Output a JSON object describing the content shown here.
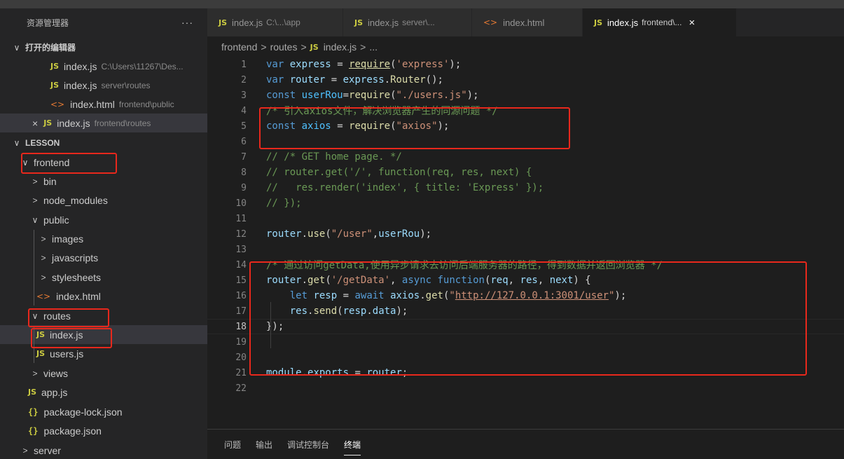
{
  "explorer": {
    "title": "资源管理器",
    "more": "···",
    "open_editors_label": "打开的编辑器",
    "open_editors": [
      {
        "name": "index.js",
        "desc": "C:\\Users\\11267\\Des..."
      },
      {
        "name": "index.js",
        "desc": "server\\routes"
      },
      {
        "name": "index.html",
        "desc": "frontend\\public"
      },
      {
        "name": "index.js",
        "desc": "frontend\\routes"
      }
    ],
    "workspace_label": "LESSON",
    "tree": {
      "frontend": "frontend",
      "bin": "bin",
      "node_modules": "node_modules",
      "public": "public",
      "images": "images",
      "javascripts": "javascripts",
      "stylesheets": "stylesheets",
      "index_html": "index.html",
      "routes": "routes",
      "index_js": "index.js",
      "users_js": "users.js",
      "views": "views",
      "app_js": "app.js",
      "package_lock": "package-lock.json",
      "package_json": "package.json",
      "server": "server"
    }
  },
  "tabs": [
    {
      "name": "index.js",
      "desc": "C:\\...\\app"
    },
    {
      "name": "index.js",
      "desc": "server\\..."
    },
    {
      "name": "index.html",
      "desc": ""
    },
    {
      "name": "index.js",
      "desc": "frontend\\..."
    }
  ],
  "icons": {
    "js": "JS",
    "html": "<>",
    "json": "{}",
    "close": "×",
    "chevron_down": "∨",
    "chevron_right": ">"
  },
  "breadcrumb": {
    "part1": "frontend",
    "part2": "routes",
    "part3": "index.js",
    "part4": "..."
  },
  "code": {
    "l1_a": "var",
    "l1_b": "express",
    "l1_c": "=",
    "l1_d": "require",
    "l1_e": "'express'",
    "l1_f": ";",
    "l2_a": "var",
    "l2_b": "router",
    "l2_c": "=",
    "l2_d": "express",
    "l2_e": "Router",
    "l2_f": "();",
    "l3_a": "const",
    "l3_b": "userRou",
    "l3_c": "=",
    "l3_d": "require",
    "l3_e": "\"./users.js\"",
    "l3_f": ");",
    "l4": "/* 引入axios文件，解决浏览器产生的同源问题 */",
    "l5_a": "const",
    "l5_b": "axios",
    "l5_c": "=",
    "l5_d": "require",
    "l5_e": "\"axios\"",
    "l5_f": ");",
    "l7": "// /* GET home page. */",
    "l8": "// router.get('/', function(req, res, next) {",
    "l9": "//   res.render('index', { title: 'Express' });",
    "l10": "// });",
    "l12_a": "router",
    "l12_b": "use",
    "l12_c": "\"/user\"",
    "l12_d": "userRou",
    "l12_e": ");",
    "l14": "/* 通过访问getData,使用异步请求去访问后端服务器的路径，得到数据并返回浏览器 */",
    "l15_a": "router",
    "l15_b": "get",
    "l15_c": "'/getData'",
    "l15_d": "async",
    "l15_e": "function",
    "l15_f": "req",
    "l15_g": "res",
    "l15_h": "next",
    "l15_i": "{",
    "l16_a": "let",
    "l16_b": "resp",
    "l16_c": "await",
    "l16_d": "axios",
    "l16_e": "get",
    "l16_f": "\"",
    "l16_g": "http://127.0.0.1:3001/user",
    "l16_h": "\"",
    "l16_i": ");",
    "l17_a": "res",
    "l17_b": "send",
    "l17_c": "resp",
    "l17_d": "data",
    "l17_e": ");",
    "l18": "});",
    "l21_a": "module",
    "l21_b": "exports",
    "l21_c": "router",
    "l21_d": ";"
  },
  "line_numbers": [
    "1",
    "2",
    "3",
    "4",
    "5",
    "6",
    "7",
    "8",
    "9",
    "10",
    "11",
    "12",
    "13",
    "14",
    "15",
    "16",
    "17",
    "18",
    "19",
    "20",
    "21",
    "22"
  ],
  "panel": {
    "tabs": [
      "问题",
      "输出",
      "调试控制台",
      "终端"
    ],
    "active": "终端"
  },
  "colors": {
    "highlight": "#e8281c",
    "js_icon": "#cbcb41",
    "html_icon": "#e37933",
    "keyword": "#569cd6",
    "string": "#ce9178",
    "comment": "#6a9955"
  }
}
